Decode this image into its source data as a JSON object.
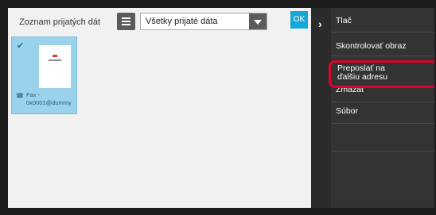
{
  "main": {
    "title": "Zoznam prijatých dát",
    "filter": {
      "selected": "Všetky prijaté dáta"
    },
    "ok_label": "OK",
    "thumbnail": {
      "sender_line1": "Fax -",
      "sender_line2": "0x0001@dummy"
    }
  },
  "side": {
    "print": "Tlač",
    "check": "Skontrolovať obraz",
    "forward_line1": "Preposlať na",
    "forward_line2": "ďalšiu adresu",
    "delete": "Zmazať",
    "file": "Súbor"
  },
  "colors": {
    "accent": "#19a6d6",
    "highlight": "#e0002a",
    "thumbnail_bg": "#9ad2ec"
  }
}
